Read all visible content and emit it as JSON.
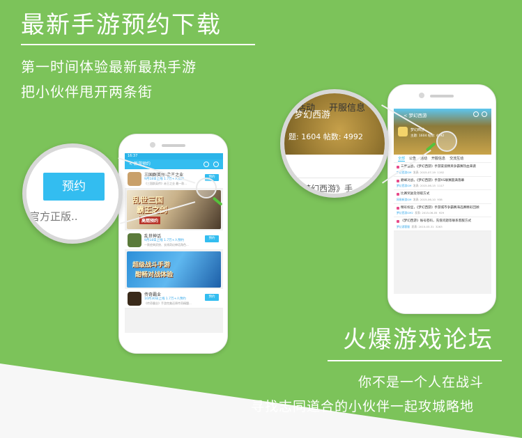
{
  "hero": {
    "title": "最新手游预约下载",
    "line1": "第一时间体验最新最热手游",
    "line2": "把小伙伴甩开两条街"
  },
  "forum_promo": {
    "title": "火爆游戏论坛",
    "line1": "你不是一个人在战斗",
    "line2": "寻找志同道合的小伙伴一起攻城略地"
  },
  "phone_left": {
    "status_time": "16:37",
    "appbar_title": "< 新游预约",
    "games": [
      {
        "name": "三国群英传-赤王之业",
        "date": "9月18日上线 1.7万+人预约",
        "desc": "《三国群英传》赤王之业 最一款...",
        "button": "预约"
      },
      {
        "name": "乱世神话",
        "date": "9月18日上线 1.7万+人预约",
        "desc": "一款经典武侠、长线奇幻神话角色...",
        "button": "预约"
      },
      {
        "name": "传奇霸业",
        "date": "10月30日上线 1.7万+人预约",
        "desc": "《传奇霸业》手游完美还原传奇精髓...",
        "button": "预约"
      }
    ],
    "banner1": {
      "line1": "乱世三国",
      "line2": "霸王之剑",
      "tag": "高燃预约"
    },
    "banner2": {
      "line1": "超级战斗手游",
      "line2": "酣畅对战体验"
    }
  },
  "mag_left": {
    "button": "预约",
    "text": "官方正版.."
  },
  "phone_right": {
    "appbar_title": "< 梦幻西游",
    "forum_name": "梦幻西游",
    "stats": "主题: 1604  帖数: 4992",
    "tabs": [
      "全部",
      "公告",
      "活动",
      "开服信息",
      "交流互动"
    ],
    "posts": [
      {
        "title": "三界盛战，《梦幻西游》手游渠道精英争霸赛热血来袭",
        "author": "梦幻西游GM",
        "date": "发表: 2015-07-19",
        "views": "1192"
      },
      {
        "title": "巅峰对战，《梦幻西游》手游XS联赛圆满落幕",
        "author": "梦幻西游GM",
        "date": "发表: 2015-06-15",
        "views": "1117"
      },
      {
        "title": "比赛奖励及领取方式",
        "author": "网易新游GM",
        "date": "发表: 2015-06-10",
        "views": "938"
      },
      {
        "title": "精彩纷呈，《梦幻西游》手游城市争霸赛海选赛精彩回顾",
        "author": "梦幻西游GM2",
        "date": "发表: 2015-06-05",
        "views": "929"
      },
      {
        "title": "《梦幻西游》账号密码，充值问题等联系客服方式",
        "author": "梦幻游客服",
        "date": "发表: 2015-03-31",
        "views": "3263"
      }
    ]
  },
  "mag_right": {
    "title": "梦幻西游",
    "stats": "题: 1604    帖数: 4992",
    "tab1": "活动",
    "tab2": "开服信息",
    "post": "《梦幻西游》手"
  },
  "colors": {
    "background": "#7cc35a",
    "accent": "#33bdf0"
  }
}
